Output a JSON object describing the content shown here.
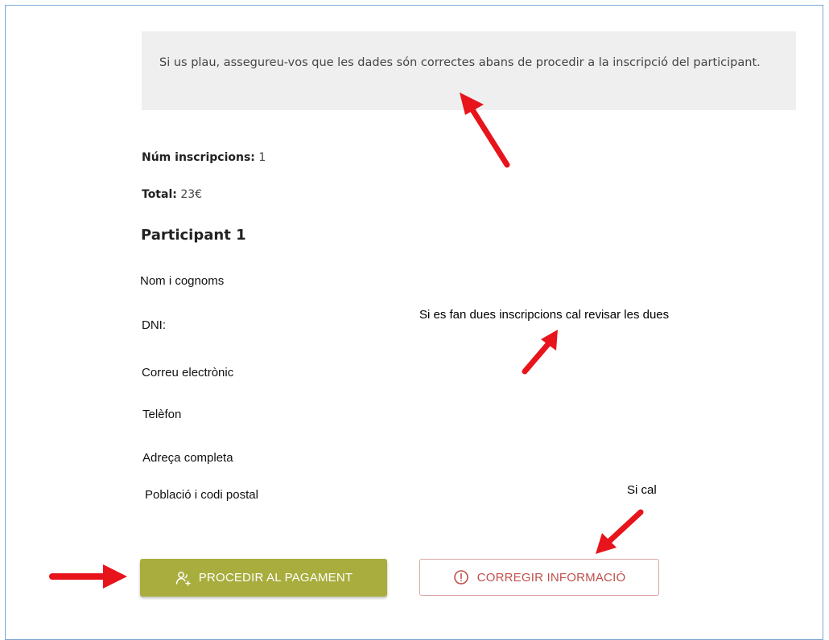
{
  "notice": {
    "text": "Si us plau, assegureu-vos que les dades són correctes abans de procedir a la inscripció del participant."
  },
  "summary": {
    "num_label": "Núm inscripcions:",
    "num_value": "1",
    "total_label": "Total:",
    "total_value": "23€"
  },
  "participant": {
    "title": "Participant 1",
    "fields": [
      "Nom i cognoms",
      "DNI:",
      "Correu electrònic",
      "Telèfon",
      "Adreça completa",
      "Població i codi postal"
    ]
  },
  "annotations": {
    "review_note": "Si es fan dues inscripcions cal revisar les dues",
    "if_needed": "Si cal"
  },
  "buttons": {
    "pay_label": "PROCEDIR AL PAGAMENT",
    "fix_label": "CORREGIR INFORMACIÓ"
  },
  "colors": {
    "pay_button": "#a8ad3d",
    "fix_button_text": "#c0504d",
    "notice_bg": "#efefef",
    "arrow": "#e8141c"
  },
  "icons": {
    "pay": "users-icon",
    "fix": "alert-circle-icon"
  }
}
